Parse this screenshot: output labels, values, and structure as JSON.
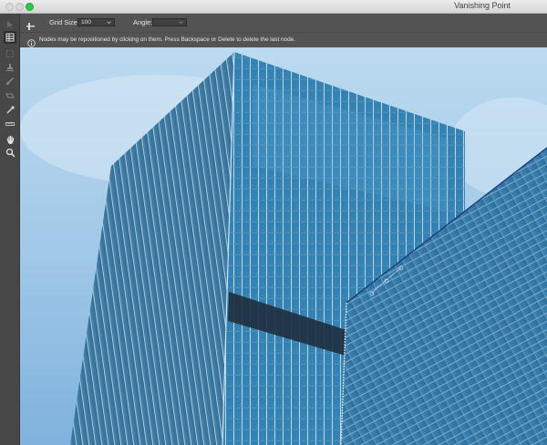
{
  "window": {
    "title": "Vanishing Point"
  },
  "options": {
    "grid_size_label": "Grid Size:",
    "grid_size_value": "100",
    "angle_label": "Angle:",
    "angle_value": ""
  },
  "message": {
    "text": "Nodes may be repositioned by clicking on them.  Press Backspace or Delete to delete the last node."
  },
  "tools": [
    {
      "name": "edit-plane-tool-icon"
    },
    {
      "name": "create-plane-tool-icon"
    },
    {
      "name": "marquee-tool-icon"
    },
    {
      "name": "stamp-tool-icon"
    },
    {
      "name": "brush-tool-icon"
    },
    {
      "name": "transform-tool-icon"
    },
    {
      "name": "eyedropper-tool-icon"
    },
    {
      "name": "measure-tool-icon"
    },
    {
      "name": "hand-tool-icon"
    },
    {
      "name": "zoom-tool-icon"
    }
  ],
  "colors": {
    "accent_green": "#2ec94a",
    "panel": "#535353",
    "sky": "#9fc6e6"
  }
}
